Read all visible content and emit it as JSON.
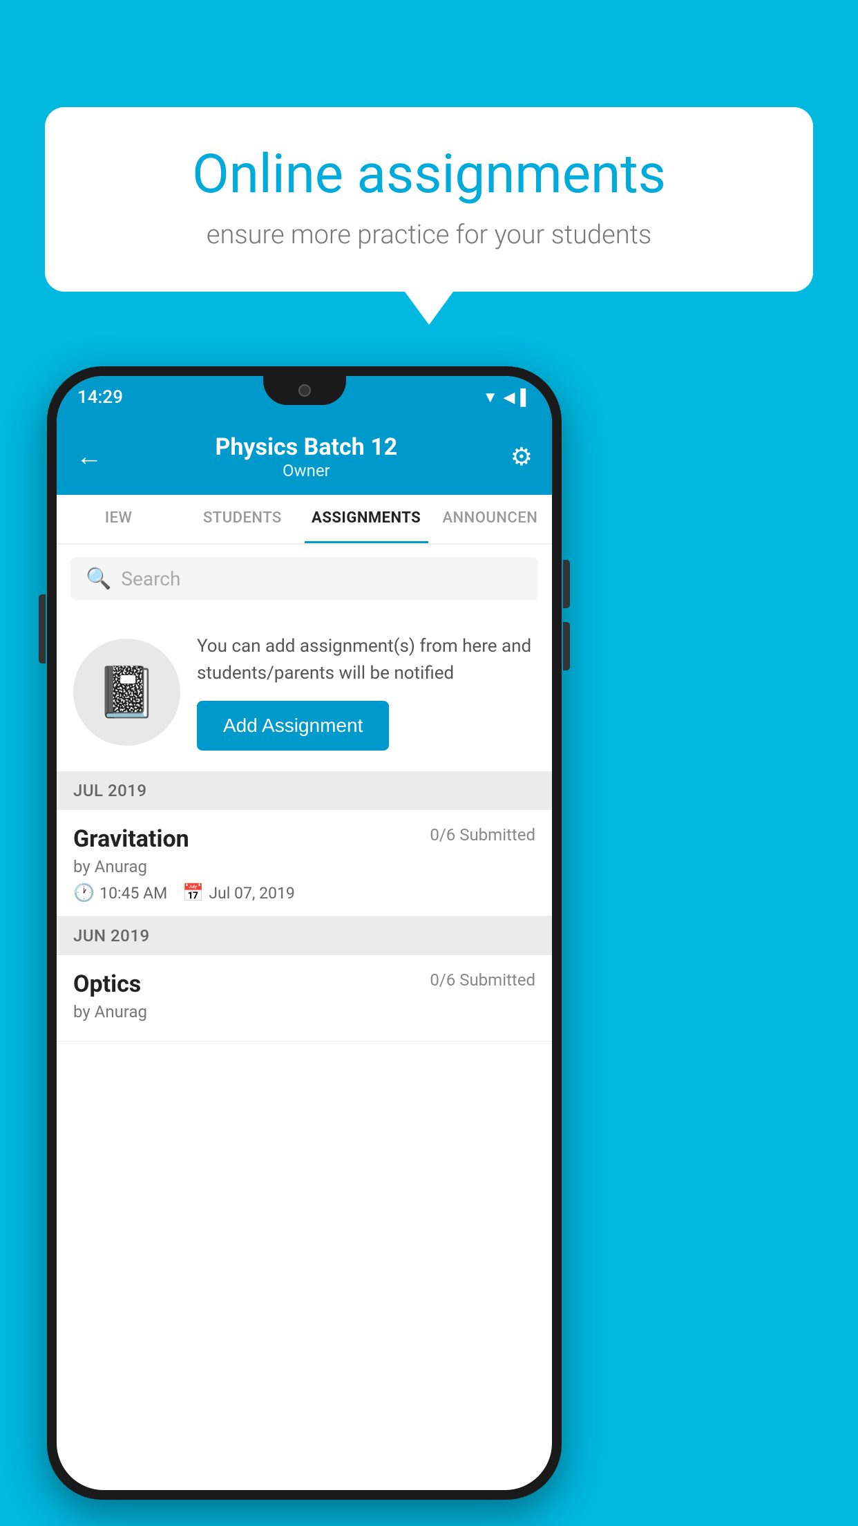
{
  "background_color": "#00b8e0",
  "speech_bubble": {
    "title": "Online assignments",
    "subtitle": "ensure more practice for your students"
  },
  "status_bar": {
    "time": "14:29",
    "icons": "▼ ◀ ▌"
  },
  "app_bar": {
    "title": "Physics Batch 12",
    "subtitle": "Owner",
    "back_label": "←",
    "settings_label": "⚙"
  },
  "tabs": [
    {
      "label": "IEW",
      "active": false
    },
    {
      "label": "STUDENTS",
      "active": false
    },
    {
      "label": "ASSIGNMENTS",
      "active": true
    },
    {
      "label": "ANNOUNCEN",
      "active": false
    }
  ],
  "search": {
    "placeholder": "Search"
  },
  "info_section": {
    "text": "You can add assignment(s) from here and students/parents will be notified",
    "button_label": "Add Assignment"
  },
  "assignments": [
    {
      "section": "JUL 2019",
      "items": [
        {
          "name": "Gravitation",
          "submitted": "0/6 Submitted",
          "by": "by Anurag",
          "time": "10:45 AM",
          "date": "Jul 07, 2019"
        }
      ]
    },
    {
      "section": "JUN 2019",
      "items": [
        {
          "name": "Optics",
          "submitted": "0/6 Submitted",
          "by": "by Anurag",
          "time": "",
          "date": ""
        }
      ]
    }
  ]
}
